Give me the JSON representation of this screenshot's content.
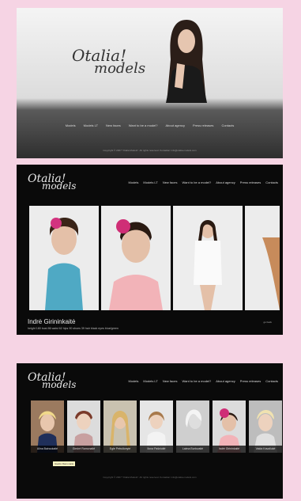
{
  "colors": {
    "background": "#f6d4e4",
    "dark": "#0a0a0a"
  },
  "panel1": {
    "logo_line1": "Otalia!",
    "logo_line2": "models",
    "nav": [
      "Models",
      "Models LT",
      "New faces",
      "Want to be a model?",
      "About agency",
      "Press releases",
      "Contacts"
    ],
    "footer": "Copyright © 2007 \"Otalia Models\". All rights reserved. Kontaktai: info@otalia-models.com"
  },
  "panel2": {
    "logo_line1": "Otalia!",
    "logo_line2": "models",
    "nav": [
      "Models",
      "Models LT",
      "New faces",
      "Want to be a model?",
      "About agency",
      "Press releases",
      "Contacts"
    ],
    "model_name": "Indrė Girininkaitė",
    "model_desc": "height 180 bust 86 waist 62 hips 90 shoes 39 hair black eyes blue/green",
    "detail_link": "go back"
  },
  "panel3": {
    "logo_line1": "Otalia!",
    "logo_line2": "models",
    "nav": [
      "Models",
      "Models LT",
      "New faces",
      "Want to be a model?",
      "About agency",
      "Press releases",
      "Contacts"
    ],
    "thumbs": [
      "Alina Bairaukaitė",
      "Giedrė Ramonaitė",
      "Egle Petrulionytė",
      "Ilona Pašnioitė",
      "Laima Burtovaitė",
      "Indrė Girininkaitė",
      "Vaida Kavaliukė"
    ],
    "tooltip": "Giedrė Ramonaitė",
    "footer": "Copyright © 2007 \"Otalia Models\". All rights reserved. Kontaktai: info@otalia-models.com"
  }
}
